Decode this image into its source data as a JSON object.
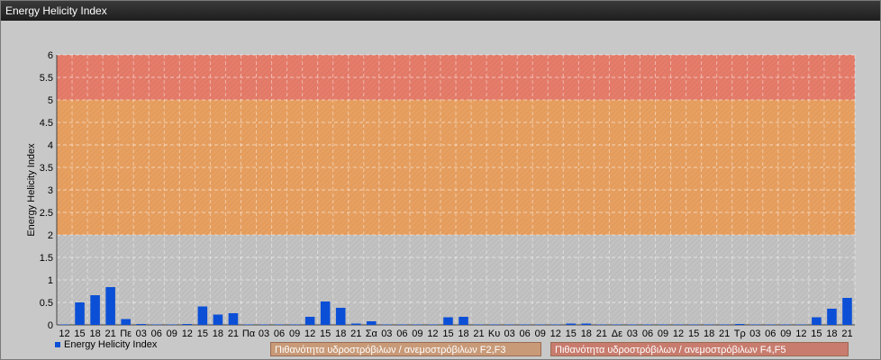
{
  "window": {
    "title": "Energy Helicity Index"
  },
  "legend": {
    "series_label": "Energy Helicity Index"
  },
  "zones": [
    {
      "label": "Πιθανότητα υδροστρόβιλων / ανεμοστρόβιλων F2,F3",
      "from": 2,
      "to": 5,
      "color": "#e8a060"
    },
    {
      "label": "Πιθανότητα υδροστρόβιλων / ανεμοστρόβιλων F4,F5",
      "from": 5,
      "to": 6,
      "color": "#e67c6a"
    }
  ],
  "colors": {
    "bar": "#0b4fd6",
    "plot_bg": "#c2c2c2",
    "zone1_box": "#c89a78",
    "zone2_box": "#c87c6e"
  },
  "chart_data": {
    "type": "bar",
    "ylabel": "Energy Helicity Index",
    "ylim": [
      0,
      6
    ],
    "yticks": [
      0,
      0.5,
      1,
      1.5,
      2,
      2.5,
      3,
      3.5,
      4,
      4.5,
      5,
      5.5,
      6
    ],
    "grid": true,
    "legend_position": "bottom-left",
    "categories": [
      "12",
      "15",
      "18",
      "21",
      "Πε",
      "03",
      "06",
      "09",
      "12",
      "15",
      "18",
      "21",
      "Πα",
      "03",
      "06",
      "09",
      "12",
      "15",
      "18",
      "21",
      "Σα",
      "03",
      "06",
      "09",
      "12",
      "15",
      "18",
      "21",
      "Κυ",
      "03",
      "06",
      "09",
      "12",
      "15",
      "18",
      "21",
      "Δε",
      "03",
      "06",
      "09",
      "12",
      "15",
      "18",
      "21",
      "Τρ",
      "03",
      "06",
      "09",
      "12",
      "15",
      "18",
      "21"
    ],
    "series": [
      {
        "name": "Energy Helicity Index",
        "values": [
          0.01,
          0.5,
          0.66,
          0.84,
          0.13,
          0.02,
          0.01,
          0.01,
          0.02,
          0.41,
          0.23,
          0.26,
          0.01,
          0.01,
          0.01,
          0.01,
          0.18,
          0.52,
          0.38,
          0.03,
          0.08,
          0.01,
          0.01,
          0.01,
          0.01,
          0.17,
          0.18,
          0.01,
          0.01,
          0.01,
          0.01,
          0.01,
          0.01,
          0.03,
          0.03,
          0.01,
          0.01,
          0.01,
          0.01,
          0.01,
          0.01,
          0.01,
          0.01,
          0.01,
          0.02,
          0.01,
          0.01,
          0.01,
          0.01,
          0.17,
          0.36,
          0.6
        ]
      }
    ]
  }
}
